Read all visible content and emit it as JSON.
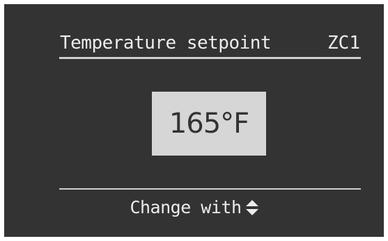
{
  "header": {
    "title": "Temperature setpoint",
    "zone": "ZC1"
  },
  "setpoint": {
    "value": "165°F"
  },
  "footer": {
    "hint": "Change with",
    "icon": "up-down-arrows-icon"
  },
  "colors": {
    "screen_background": "#333333",
    "text": "#ececec",
    "value_box": "#d6d6d6",
    "value_text": "#333333"
  }
}
